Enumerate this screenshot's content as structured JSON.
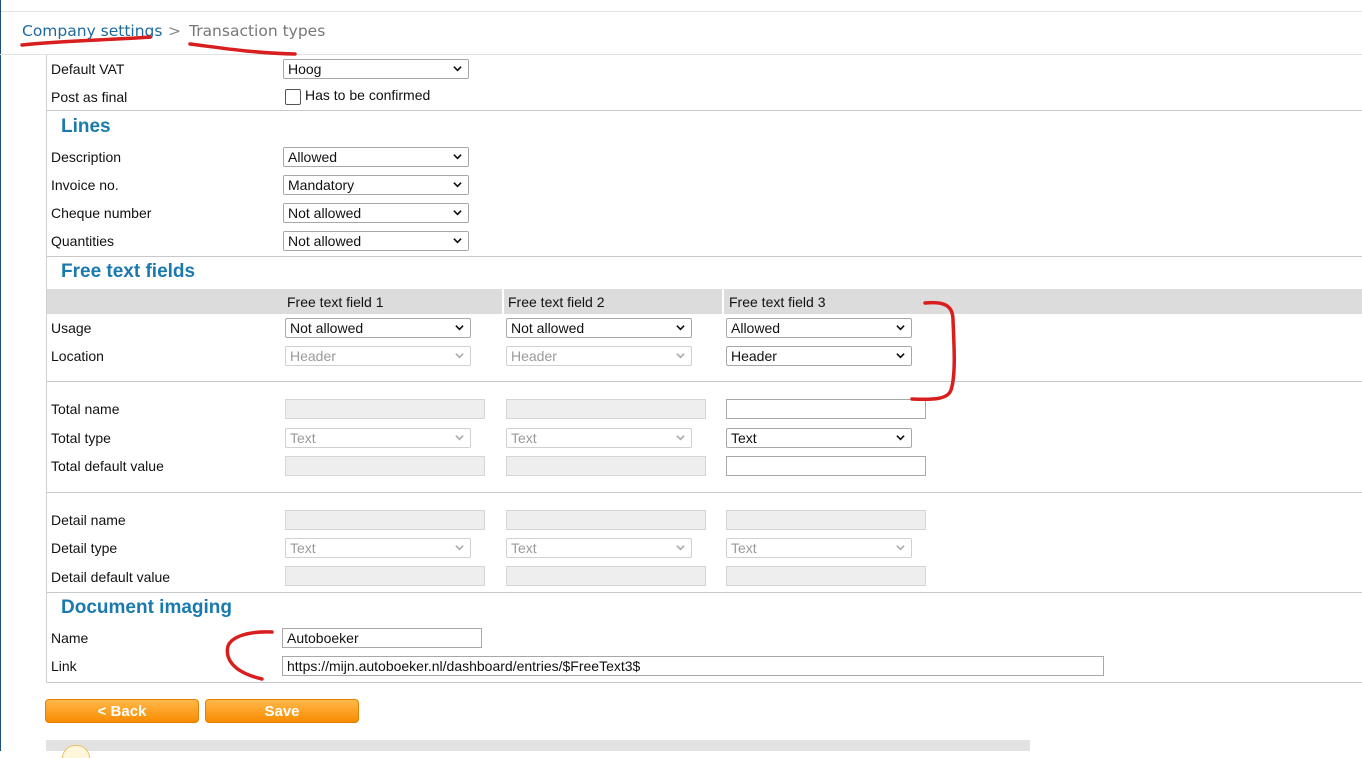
{
  "breadcrumb": {
    "parent": "Company settings",
    "separator": ">",
    "current": "Transaction types"
  },
  "general": {
    "default_vat": {
      "label": "Default VAT",
      "value": "Hoog"
    },
    "post_as_final": {
      "label": "Post as final",
      "checkbox_label": "Has to be confirmed",
      "checked": false
    }
  },
  "lines": {
    "title": "Lines",
    "rows": [
      {
        "label": "Description",
        "value": "Allowed"
      },
      {
        "label": "Invoice no.",
        "value": "Mandatory"
      },
      {
        "label": "Cheque number",
        "value": "Not allowed"
      },
      {
        "label": "Quantities",
        "value": "Not allowed"
      }
    ]
  },
  "free_text_fields": {
    "title": "Free text fields",
    "columns": [
      "Free text field 1",
      "Free text field 2",
      "Free text field 3"
    ],
    "usage": {
      "label": "Usage",
      "values": [
        "Not allowed",
        "Not allowed",
        "Allowed"
      ]
    },
    "location": {
      "label": "Location",
      "values": [
        "Header",
        "Header",
        "Header"
      ]
    },
    "total_name": {
      "label": "Total name",
      "values": [
        "",
        "",
        ""
      ]
    },
    "total_type": {
      "label": "Total type",
      "values": [
        "Text",
        "Text",
        "Text"
      ]
    },
    "total_default_value": {
      "label": "Total default value",
      "values": [
        "",
        "",
        ""
      ]
    },
    "detail_name": {
      "label": "Detail name",
      "values": [
        "",
        "",
        ""
      ]
    },
    "detail_type": {
      "label": "Detail type",
      "values": [
        "Text",
        "Text",
        "Text"
      ]
    },
    "detail_default_value": {
      "label": "Detail default value",
      "values": [
        "",
        "",
        ""
      ]
    }
  },
  "document_imaging": {
    "title": "Document imaging",
    "name": {
      "label": "Name",
      "value": "Autoboeker"
    },
    "link": {
      "label": "Link",
      "value": "https://mijn.autoboeker.nl/dashboard/entries/$FreeText3$"
    }
  },
  "buttons": {
    "back": "< Back",
    "save": "Save"
  },
  "colors": {
    "section_title": "#1a7ab0",
    "button_orange": "#f98c00",
    "annotation_red": "#d81e1e"
  }
}
